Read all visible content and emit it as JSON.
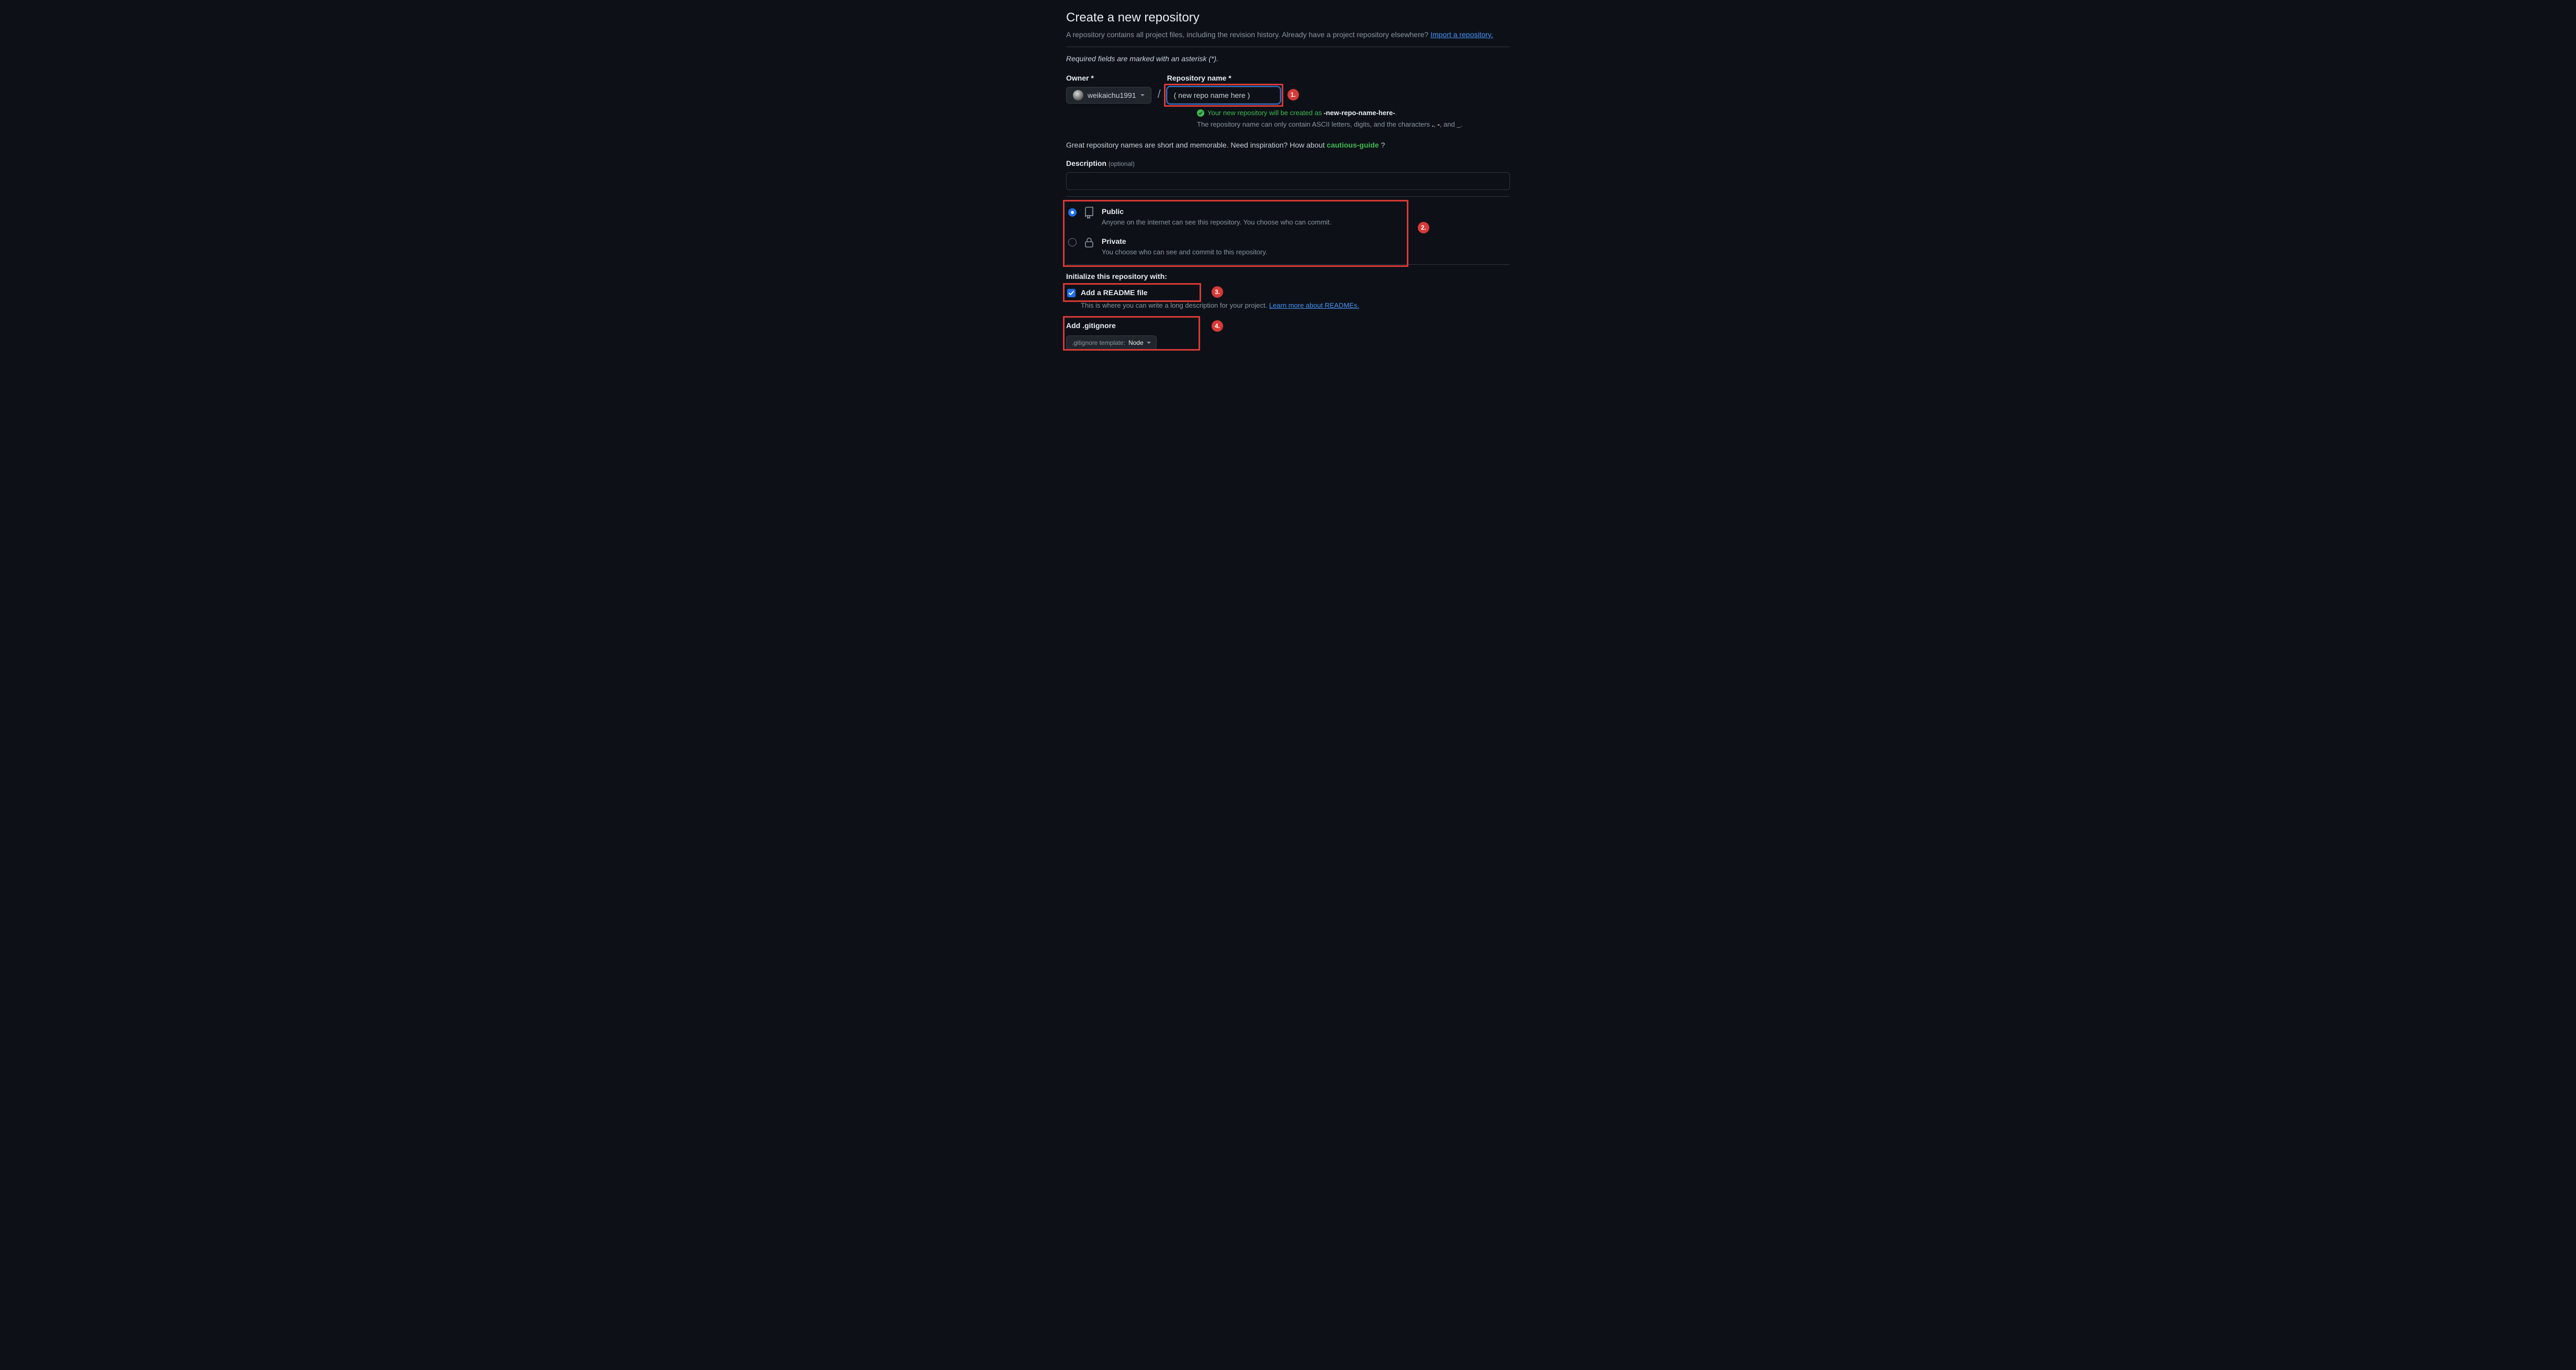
{
  "heading": "Create a new repository",
  "subhead_text": "A repository contains all project files, including the revision history. Already have a project repository elsewhere? ",
  "import_link": "Import a repository.",
  "required_note": "Required fields are marked with an asterisk (*).",
  "owner": {
    "label": "Owner *",
    "username": "weikaichu1991"
  },
  "repo_name": {
    "label": "Repository name *",
    "value": "( new repo name here )",
    "valid_prefix": "Your new repository will be created as ",
    "valid_name": "-new-repo-name-here-",
    "valid_suffix": ".",
    "hint_prefix": "The repository name can only contain ASCII letters, digits, and the characters ",
    "hint_chars1": ".",
    "hint_sep1": ", ",
    "hint_chars2": "-",
    "hint_sep2": ", and ",
    "hint_chars3": "_",
    "hint_end": "."
  },
  "inspiration": {
    "text": "Great repository names are short and memorable. Need inspiration? How about ",
    "suggestion": "cautious-guide",
    "suffix": " ?"
  },
  "description": {
    "label": "Description",
    "optional": "(optional)",
    "value": ""
  },
  "visibility": {
    "public": {
      "title": "Public",
      "desc": "Anyone on the internet can see this repository. You choose who can commit."
    },
    "private": {
      "title": "Private",
      "desc": "You choose who can see and commit to this repository."
    }
  },
  "init_label": "Initialize this repository with:",
  "readme": {
    "label": "Add a README file",
    "desc": "This is where you can write a long description for your project. ",
    "link": "Learn more about READMEs."
  },
  "gitignore": {
    "title": "Add .gitignore",
    "prefix": ".gitignore template:",
    "value": "Node"
  },
  "callouts": {
    "one": "1.",
    "two": "2.",
    "three": "3.",
    "four": "4."
  }
}
